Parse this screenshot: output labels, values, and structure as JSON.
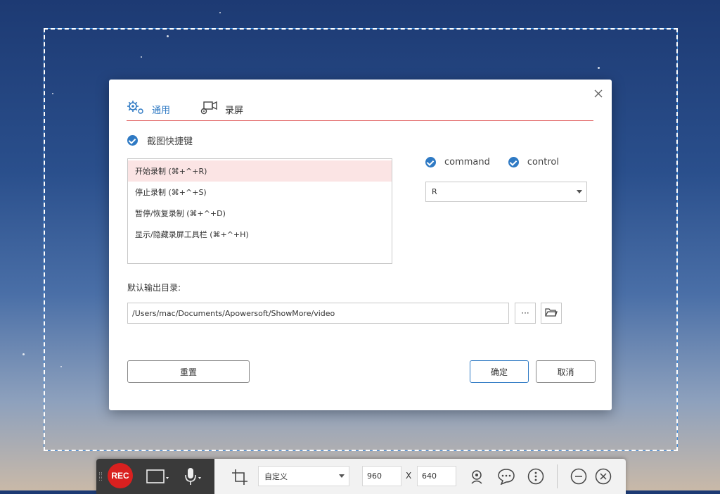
{
  "dialog": {
    "tabs": [
      {
        "label": "通用",
        "icon": "gears-icon"
      },
      {
        "label": "录屏",
        "icon": "screen-camera-icon"
      }
    ],
    "close_icon": "close-icon",
    "hotkey_toggle_label": "截图快捷键",
    "hotkeys": [
      {
        "label": "开始录制 (⌘+^+R)"
      },
      {
        "label": "停止录制 (⌘+^+S)"
      },
      {
        "label": "暂停/恢复录制 (⌘+^+D)"
      },
      {
        "label": "显示/隐藏录屏工具栏 (⌘+^+H)"
      }
    ],
    "selected_hotkey_index": 0,
    "modifiers": {
      "command": "command",
      "control": "control"
    },
    "key_value": "R",
    "output_dir_label": "默认输出目录:",
    "output_dir_value": "/Users/mac/Documents/Apowersoft/ShowMore/video",
    "more_button_label": "···",
    "buttons": {
      "reset": "重置",
      "ok": "确定",
      "cancel": "取消"
    },
    "accent_color": "#2f7ac4",
    "tab_underline_color": "#e05a5a"
  },
  "toolbar": {
    "rec_label": "REC",
    "preset_value": "自定义",
    "width_value": "960",
    "height_value": "640",
    "x_label": "X",
    "rec_color": "#d9201f"
  }
}
